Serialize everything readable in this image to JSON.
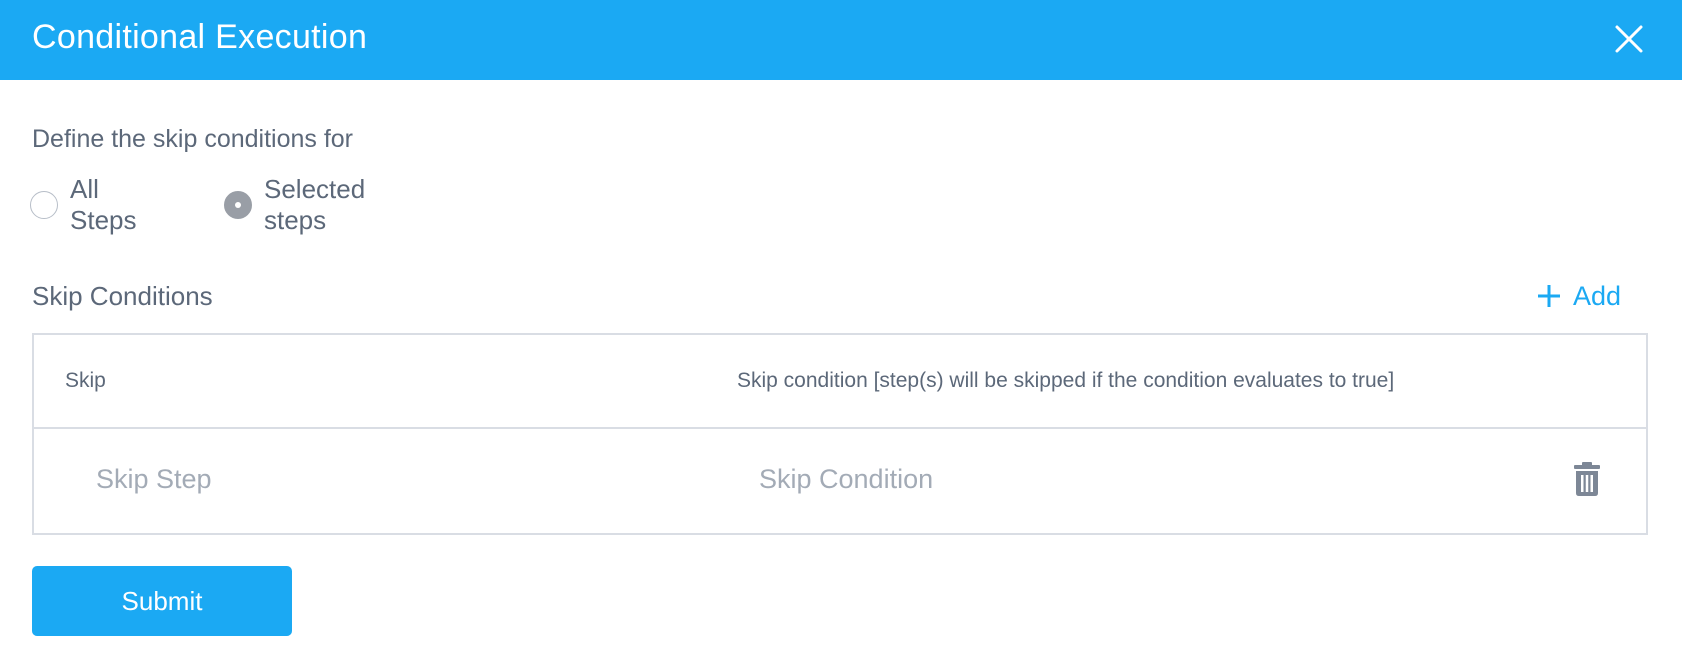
{
  "dialog": {
    "title": "Conditional Execution",
    "close_icon": "close-icon"
  },
  "scope": {
    "prompt": "Define the skip conditions for",
    "options": [
      {
        "label": "All Steps",
        "checked": false
      },
      {
        "label": "Selected steps",
        "checked": true
      }
    ]
  },
  "skip_conditions": {
    "title": "Skip Conditions",
    "add_label": "Add",
    "add_icon": "plus-icon",
    "columns": [
      "Skip",
      "Skip condition [step(s) will be skipped if the condition evaluates to true]"
    ],
    "rows": [
      {
        "skip_value": "",
        "skip_placeholder": "Skip Step",
        "condition_value": "",
        "condition_placeholder": "Skip Condition",
        "delete_icon": "trash-icon"
      }
    ]
  },
  "submit_label": "Submit",
  "colors": {
    "accent": "#1ba9f3",
    "text": "#5c6879",
    "placeholder": "#a3abb6",
    "border": "#d9dde4"
  }
}
